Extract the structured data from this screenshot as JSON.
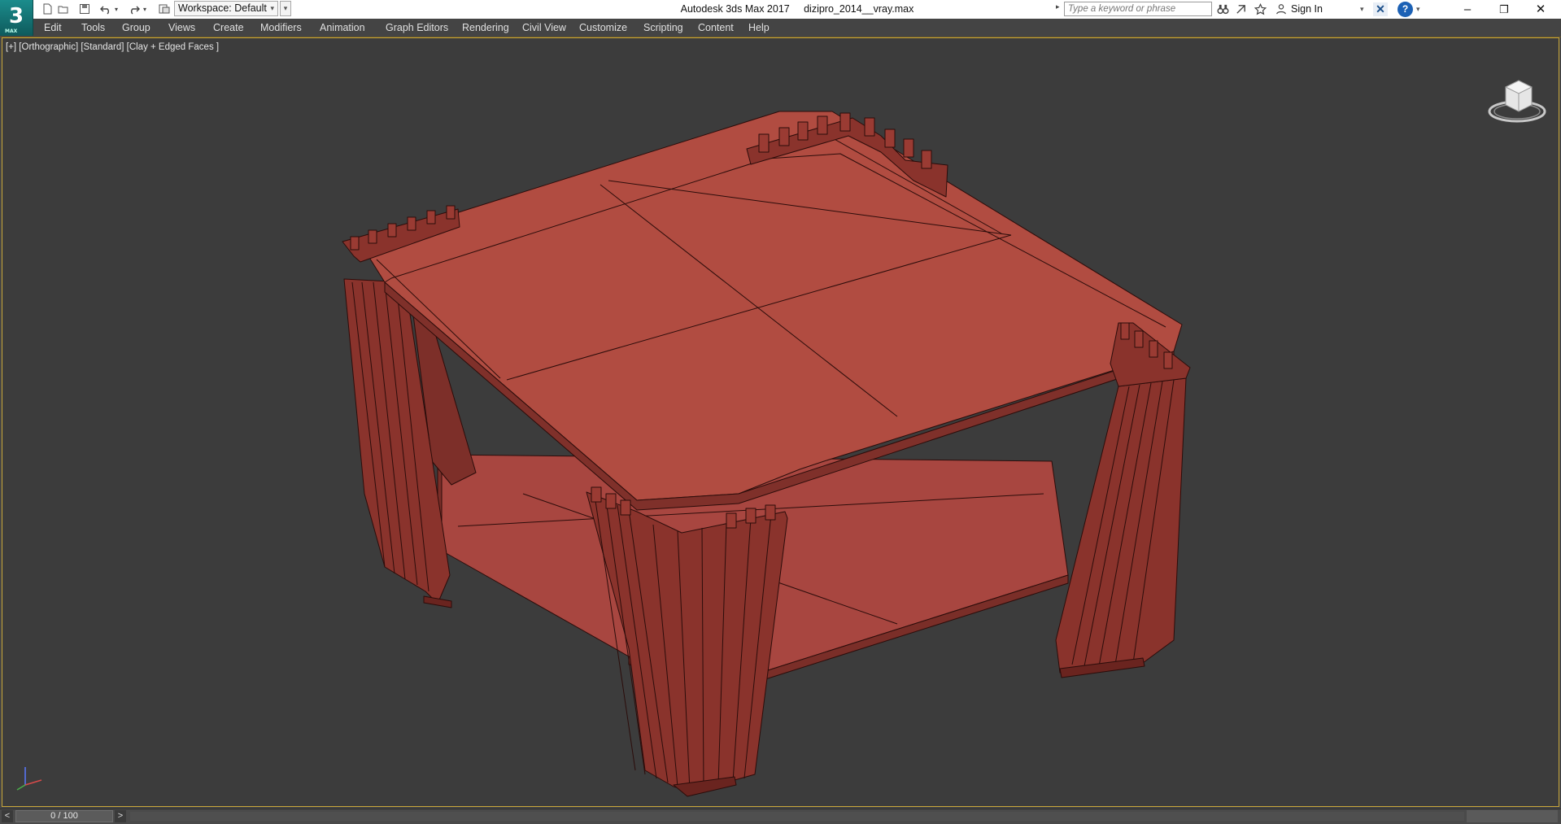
{
  "app": {
    "logo_text": "3",
    "logo_sub": "MAX",
    "window_title": "Autodesk 3ds Max 2017     dizipro_2014__vray.max"
  },
  "toolbar": {
    "workspace_label": "Workspace: Default",
    "search_placeholder": "Type a keyword or phrase",
    "signin_label": "Sign In",
    "quick_access_icons": [
      "new-file-icon",
      "open-file-icon",
      "save-icon",
      "undo-icon",
      "redo-icon",
      "project-folder-icon"
    ]
  },
  "menu": {
    "items": [
      "Edit",
      "Tools",
      "Group",
      "Views",
      "Create",
      "Modifiers",
      "Animation",
      "Graph Editors",
      "Rendering",
      "Civil View",
      "Customize",
      "Scripting",
      "Content",
      "Help"
    ]
  },
  "viewport": {
    "label": "[+] [Orthographic] [Standard] [Clay + Edged Faces ]",
    "object_color": "#b14c41",
    "object_edge_color": "#2b0c0a",
    "background_color": "#3c3c3c"
  },
  "timeline": {
    "frame_readout": "0 / 100",
    "prev_label": "<",
    "next_label": ">"
  },
  "colors": {
    "titlebar_bg": "#ffffff",
    "menubar_bg": "#444444",
    "viewport_border": "#c9a63a",
    "accent": "#1c61b5"
  }
}
